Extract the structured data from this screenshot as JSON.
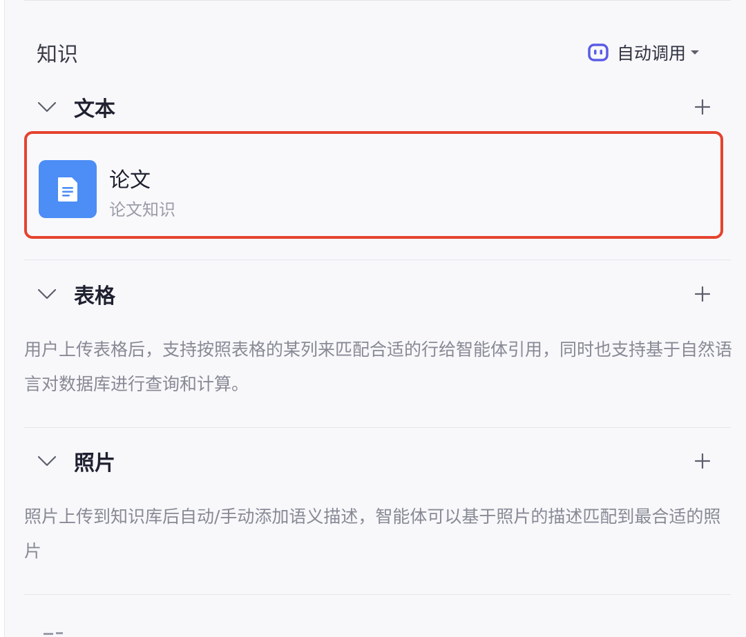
{
  "knowledge": {
    "title": "知识",
    "auto_invoke_label": "自动调用"
  },
  "sections": [
    {
      "title": "文本",
      "items": [
        {
          "title": "论文",
          "subtitle": "论文知识"
        }
      ]
    },
    {
      "title": "表格",
      "description": "用户上传表格后，支持按照表格的某列来匹配合适的行给智能体引用，同时也支持基于自然语言对数据库进行查询和计算。"
    },
    {
      "title": "照片",
      "description": "照片上传到知识库后自动/手动添加语义描述，智能体可以基于照片的描述匹配到最合适的照片"
    }
  ],
  "icons": {
    "auto_invoke": "robot-face-icon",
    "dropdown": "caret-down-icon",
    "collapse": "chevron-down-icon",
    "add": "plus-icon",
    "document": "document-icon"
  },
  "colors": {
    "highlight_border": "#e5432e",
    "doc_tile": "#4c8df6",
    "robot_icon": "#5b5ce6"
  }
}
